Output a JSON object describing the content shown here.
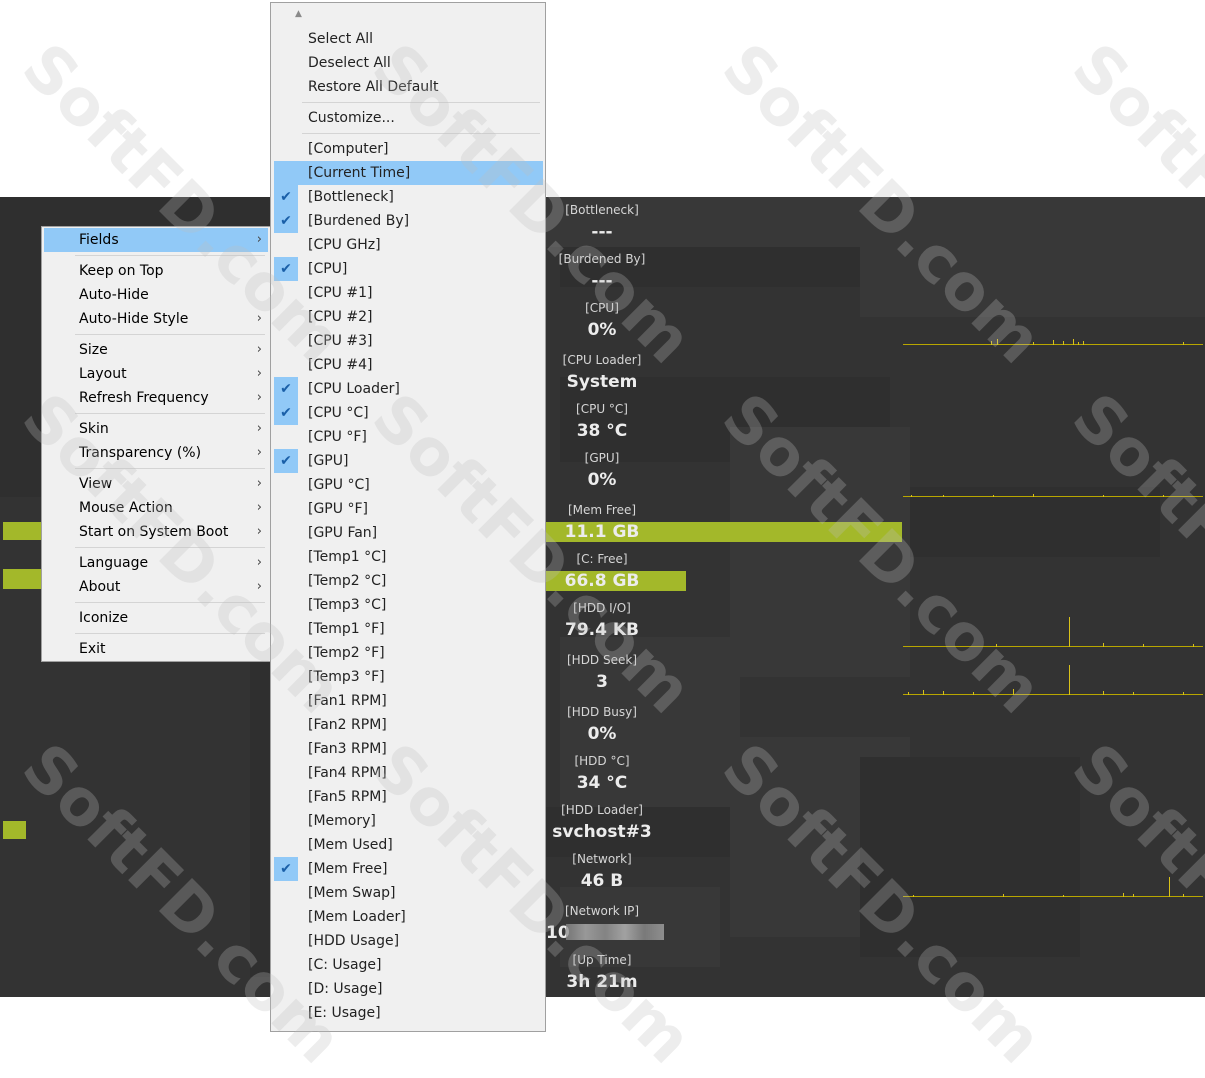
{
  "monitor": {
    "fields": [
      {
        "label": "[Bottleneck]",
        "value": "---"
      },
      {
        "label": "[Burdened By]",
        "value": "---"
      },
      {
        "label": "[CPU]",
        "value": "0%"
      },
      {
        "label": "[CPU Loader]",
        "value": "System"
      },
      {
        "label": "[CPU °C]",
        "value": "38 °C"
      },
      {
        "label": "[GPU]",
        "value": "0%"
      },
      {
        "label": "[Mem Free]",
        "value": "11.1 GB"
      },
      {
        "label": "[C: Free]",
        "value": "66.8 GB"
      },
      {
        "label": "[HDD I/O]",
        "value": "79.4 KB"
      },
      {
        "label": "[HDD Seek]",
        "value": "3"
      },
      {
        "label": "[HDD Busy]",
        "value": "0%"
      },
      {
        "label": "[HDD °C]",
        "value": "34 °C"
      },
      {
        "label": "[HDD Loader]",
        "value": "svchost#3"
      },
      {
        "label": "[Network]",
        "value": "46 B"
      },
      {
        "label": "[Network IP]",
        "value": "10"
      },
      {
        "label": "[Up Time]",
        "value": "3h 21m"
      }
    ],
    "bar_color": "#a3b82a",
    "graph_color": "#d9c21a"
  },
  "context_menu": {
    "items": [
      {
        "label": "Fields",
        "submenu": true,
        "highlighted": true
      },
      {
        "label": "Keep on Top"
      },
      {
        "label": "Auto-Hide"
      },
      {
        "label": "Auto-Hide Style",
        "submenu": true
      },
      {
        "label": "Size",
        "submenu": true
      },
      {
        "label": "Layout",
        "submenu": true
      },
      {
        "label": "Refresh Frequency",
        "submenu": true
      },
      {
        "label": "Skin",
        "submenu": true
      },
      {
        "label": "Transparency (%)",
        "submenu": true
      },
      {
        "label": "View",
        "submenu": true
      },
      {
        "label": "Mouse Action",
        "submenu": true
      },
      {
        "label": "Start on System Boot",
        "submenu": true
      },
      {
        "label": "Language",
        "submenu": true
      },
      {
        "label": "About",
        "submenu": true
      },
      {
        "label": "Iconize"
      },
      {
        "label": "Exit"
      }
    ],
    "arrow_glyph": "›"
  },
  "fields_menu": {
    "scroll_up_glyph": "▲",
    "check_glyph": "✔",
    "actions": [
      "Select All",
      "Deselect All",
      "Restore All Default"
    ],
    "customize": "Customize...",
    "items": [
      {
        "label": "[Computer]",
        "checked": false
      },
      {
        "label": "[Current Time]",
        "checked": false,
        "highlighted": true
      },
      {
        "label": "[Bottleneck]",
        "checked": true
      },
      {
        "label": "[Burdened By]",
        "checked": true
      },
      {
        "label": "[CPU GHz]",
        "checked": false
      },
      {
        "label": "[CPU]",
        "checked": true
      },
      {
        "label": "[CPU #1]",
        "checked": false
      },
      {
        "label": "[CPU #2]",
        "checked": false
      },
      {
        "label": "[CPU #3]",
        "checked": false
      },
      {
        "label": "[CPU #4]",
        "checked": false
      },
      {
        "label": "[CPU Loader]",
        "checked": true
      },
      {
        "label": "[CPU °C]",
        "checked": true
      },
      {
        "label": "[CPU °F]",
        "checked": false
      },
      {
        "label": "[GPU]",
        "checked": true
      },
      {
        "label": "[GPU °C]",
        "checked": false
      },
      {
        "label": "[GPU °F]",
        "checked": false
      },
      {
        "label": "[GPU Fan]",
        "checked": false
      },
      {
        "label": "[Temp1 °C]",
        "checked": false
      },
      {
        "label": "[Temp2 °C]",
        "checked": false
      },
      {
        "label": "[Temp3 °C]",
        "checked": false
      },
      {
        "label": "[Temp1 °F]",
        "checked": false
      },
      {
        "label": "[Temp2 °F]",
        "checked": false
      },
      {
        "label": "[Temp3 °F]",
        "checked": false
      },
      {
        "label": "[Fan1 RPM]",
        "checked": false
      },
      {
        "label": "[Fan2 RPM]",
        "checked": false
      },
      {
        "label": "[Fan3 RPM]",
        "checked": false
      },
      {
        "label": "[Fan4 RPM]",
        "checked": false
      },
      {
        "label": "[Fan5 RPM]",
        "checked": false
      },
      {
        "label": "[Memory]",
        "checked": false
      },
      {
        "label": "[Mem Used]",
        "checked": false
      },
      {
        "label": "[Mem Free]",
        "checked": true
      },
      {
        "label": "[Mem Swap]",
        "checked": false
      },
      {
        "label": "[Mem Loader]",
        "checked": false
      },
      {
        "label": "[HDD Usage]",
        "checked": false
      },
      {
        "label": "[C: Usage]",
        "checked": false
      },
      {
        "label": "[D: Usage]",
        "checked": false
      },
      {
        "label": "[E: Usage]",
        "checked": false
      }
    ]
  },
  "watermark": "SoftFD.com"
}
